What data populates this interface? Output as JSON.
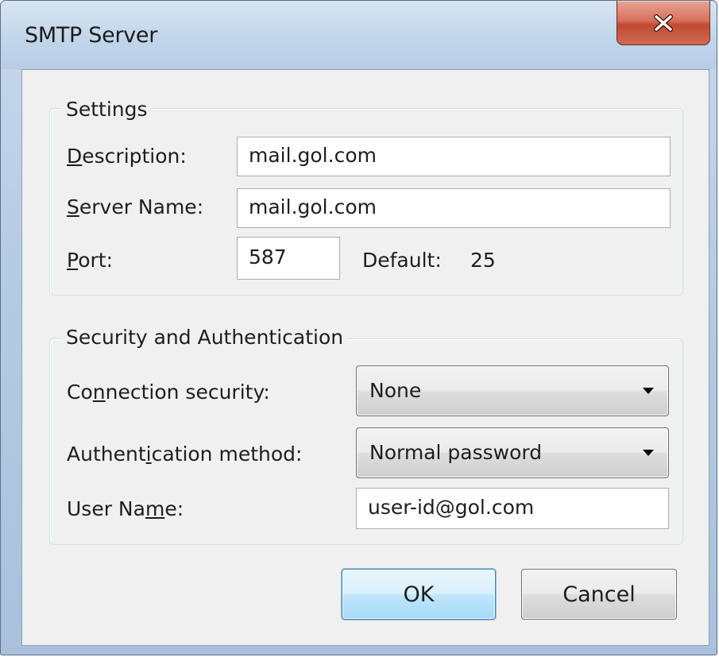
{
  "window": {
    "title": "SMTP Server",
    "close_icon": "close-x-icon"
  },
  "settings": {
    "legend": "Settings",
    "description": {
      "label": "Description:",
      "accesskey": "D",
      "value": "mail.gol.com"
    },
    "server_name": {
      "label": "Server Name:",
      "accesskey": "S",
      "value": "mail.gol.com"
    },
    "port": {
      "label": "Port:",
      "accesskey": "P",
      "value": "587",
      "default_label": "Default:",
      "default_value": "25"
    }
  },
  "security": {
    "legend": "Security and Authentication",
    "connection_security": {
      "label": "Connection security:",
      "selected": "None"
    },
    "auth_method": {
      "label": "Authentication method:",
      "selected": "Normal password"
    },
    "user_name": {
      "label": "User Name:",
      "value": "user-id@gol.com"
    }
  },
  "buttons": {
    "ok": "OK",
    "cancel": "Cancel"
  },
  "colors": {
    "close_button": "#c85a44",
    "default_button_border": "#3c7fb1",
    "frame": "#b8cde4",
    "client_bg": "#f0f0f0"
  }
}
